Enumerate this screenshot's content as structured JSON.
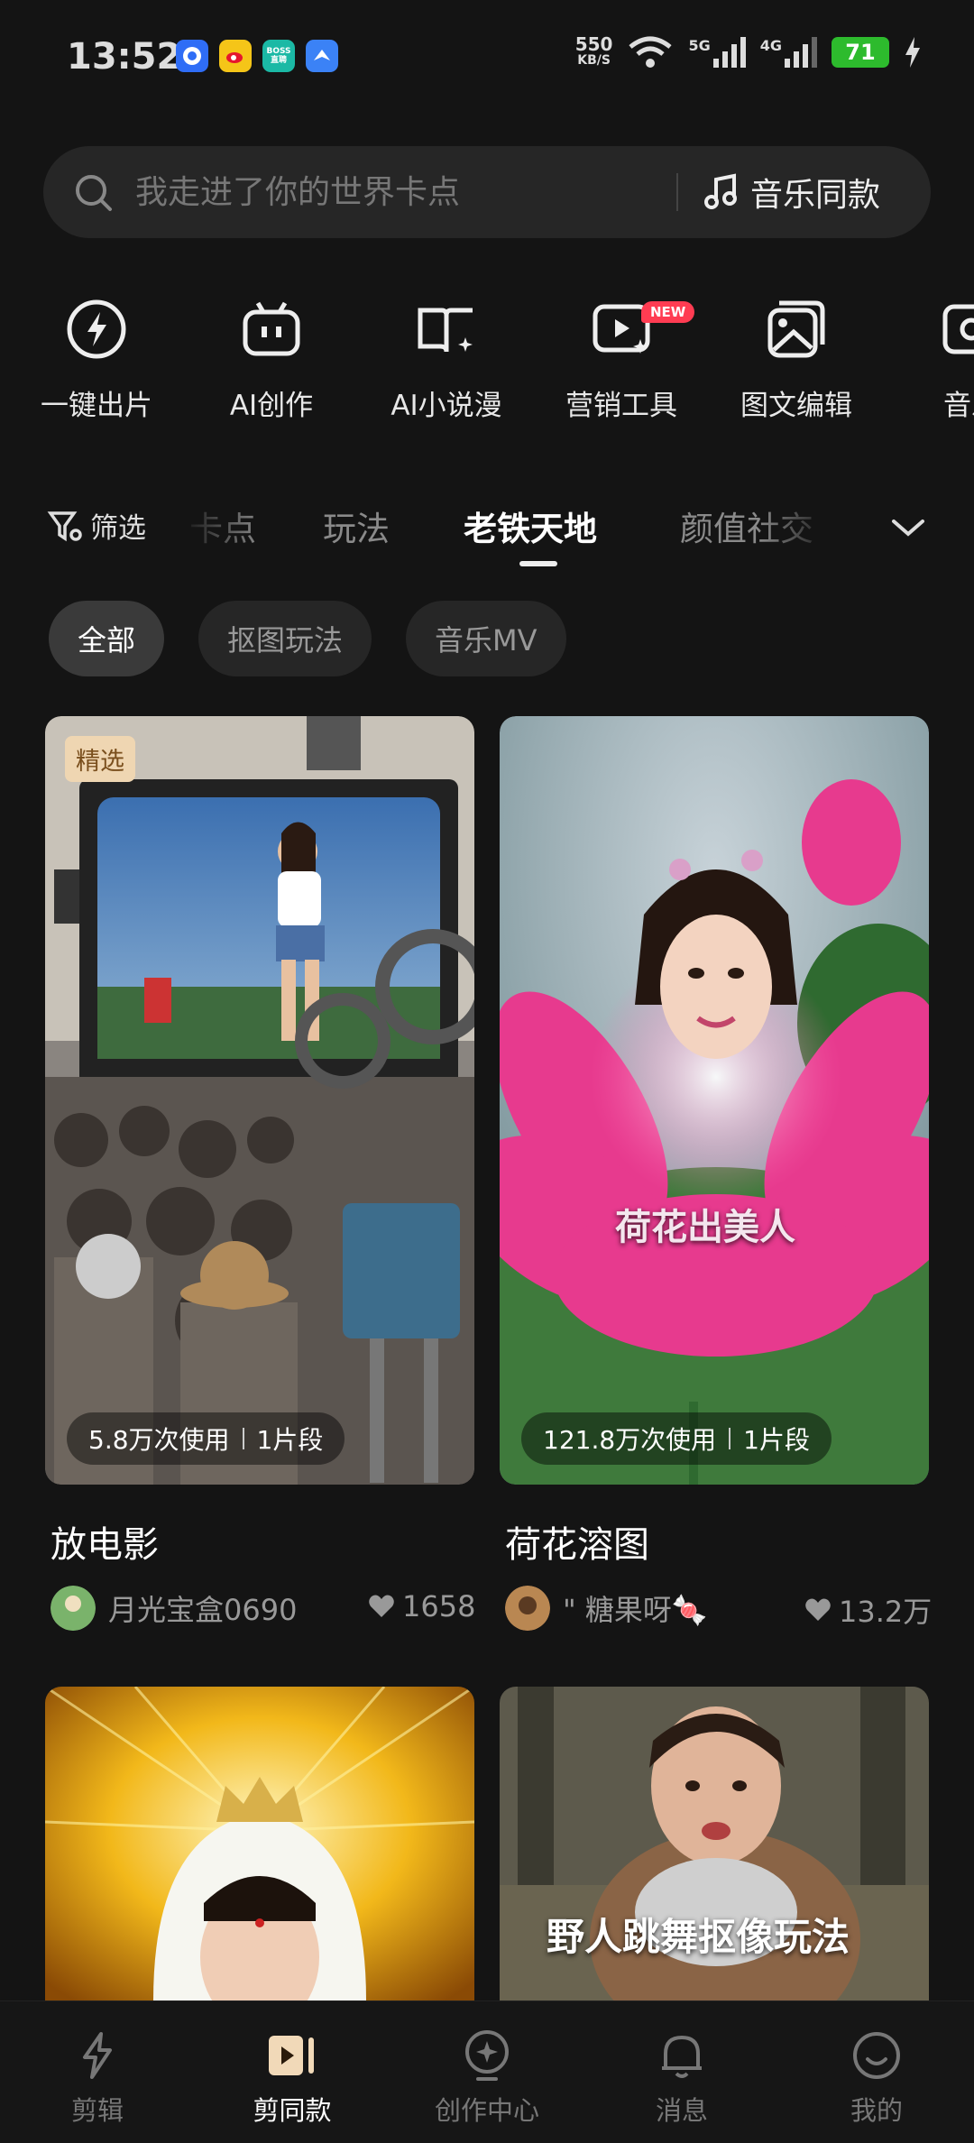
{
  "status_bar": {
    "time": "13:52",
    "net_speed_value": "550",
    "net_speed_unit": "KB/S",
    "signal_1": "5G",
    "signal_2": "4G",
    "battery": "71",
    "app_icons": [
      "browser-app-icon",
      "weibo-app-icon",
      "boss-zhipin-app-icon",
      "bird-app-icon"
    ],
    "app_icon_texts": [
      "",
      "",
      "BOSS\n直聘",
      ""
    ]
  },
  "search": {
    "placeholder": "我走进了你的世界卡点",
    "music_label": "音乐同款"
  },
  "tools": [
    {
      "label": "一键出片",
      "icon": "lightning-icon"
    },
    {
      "label": "AI创作",
      "icon": "robot-icon"
    },
    {
      "label": "AI小说漫",
      "icon": "book-sparkle-icon"
    },
    {
      "label": "营销工具",
      "icon": "play-sparkle-icon",
      "badge": "NEW"
    },
    {
      "label": "图文编辑",
      "icon": "image-edit-icon"
    },
    {
      "label": "音乐",
      "icon": "music-icon"
    }
  ],
  "categories": {
    "filter_label": "筛选",
    "items": [
      "卡点",
      "玩法",
      "老铁天地",
      "颜值社交"
    ],
    "active": "老铁天地"
  },
  "chips": [
    "全部",
    "抠图玩法",
    "音乐MV"
  ],
  "cards": [
    {
      "badge": "精选",
      "uses": "5.8万次使用",
      "segments": "1片段",
      "title": "放电影",
      "author": "月光宝盒0690",
      "likes": "1658"
    },
    {
      "overlay_text": "荷花出美人",
      "uses": "121.8万次使用",
      "segments": "1片段",
      "title": "荷花溶图",
      "author": "\" 糖果呀🍬",
      "likes": "13.2万"
    },
    {},
    {
      "overlay_text": "野人跳舞抠像玩法"
    }
  ],
  "bottom_nav": [
    {
      "label": "剪辑",
      "icon": "scissors-bolt-icon"
    },
    {
      "label": "剪同款",
      "icon": "template-play-icon"
    },
    {
      "label": "创作中心",
      "icon": "create-center-icon"
    },
    {
      "label": "消息",
      "icon": "bell-icon"
    },
    {
      "label": "我的",
      "icon": "smile-profile-icon"
    }
  ],
  "active_nav": "剪同款",
  "colors": {
    "background": "#141414",
    "new_badge": "#ff3c52",
    "battery": "#2dbb2d",
    "featured_badge": "#efd6b2"
  }
}
